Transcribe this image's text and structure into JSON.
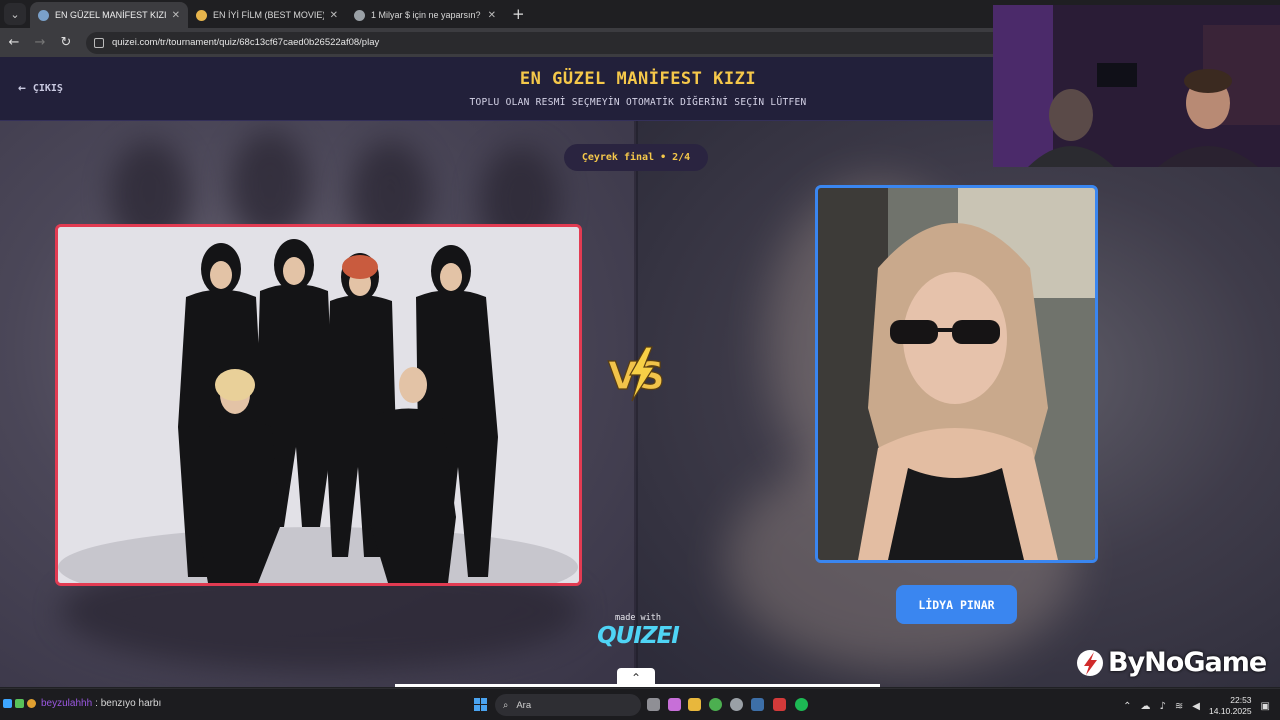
{
  "browser": {
    "tabs": [
      {
        "title": "EN GÜZEL MANİFEST KIZI - Qu",
        "active": true
      },
      {
        "title": "EN İYİ FİLM (BEST MOVIE) - Qu",
        "active": false
      },
      {
        "title": "1 Milyar $ için ne yaparsın? - Q",
        "active": false
      }
    ],
    "url": "quizei.com/tr/tournament/quiz/68c13cf67caed0b26522af08/play"
  },
  "page": {
    "exit_label": "ÇIKIŞ",
    "title": "EN GÜZEL MANİFEST KIZI",
    "subtitle": "TOPLU OLAN RESMİ SEÇMEYİN OTOMATİK DİĞERİNİ SEÇİN LÜTFEN",
    "round_label": "Çeyrek final • 2/4",
    "right_option_name": "LİDYA PINAR",
    "made_with": "made with",
    "brand_logo": "QUIZEI",
    "colors": {
      "accent_title": "#f5c84a",
      "left_border": "#e23b52",
      "right_border": "#3a86f0",
      "header_bg": "#22203a"
    }
  },
  "overlay": {
    "watermark": "ByNoGame"
  },
  "taskbar": {
    "chat_user": "beyzulahhh",
    "chat_message": ": benzıyo harbı",
    "search_placeholder": "Ara",
    "time": "22:53",
    "date": "14.10.2025"
  }
}
